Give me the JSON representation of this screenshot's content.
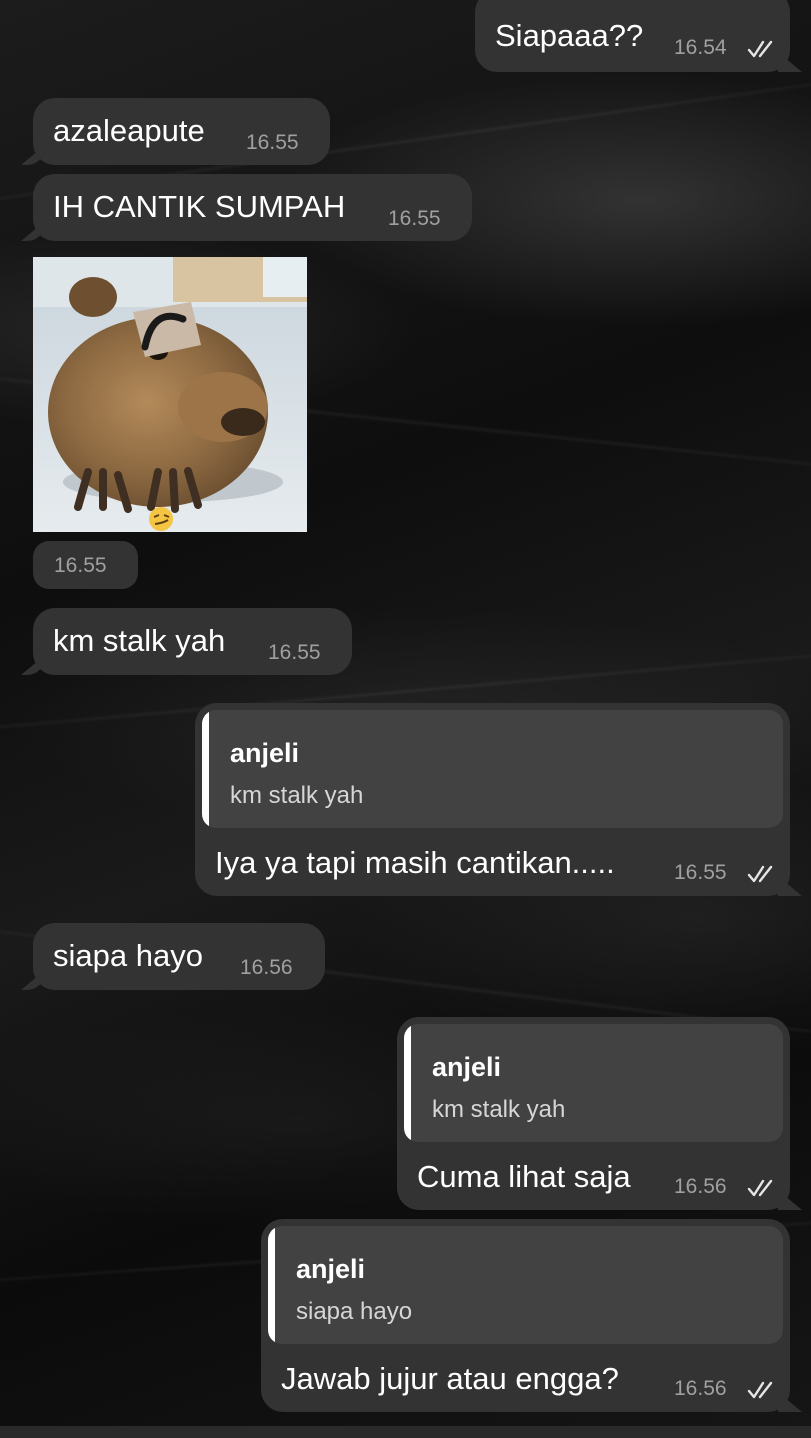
{
  "messages": {
    "m1": {
      "text": "Siapaaa??",
      "time": "16.54"
    },
    "m2": {
      "text": "azaleapute",
      "time": "16.55"
    },
    "m3": {
      "text": "IH CANTIK SUMPAH",
      "time": "16.55"
    },
    "m4": {
      "time": "16.55"
    },
    "m5": {
      "text": "km stalk yah",
      "time": "16.55"
    },
    "m6": {
      "reply_name": "anjeli",
      "reply_text": "km stalk yah",
      "text": "Iya ya tapi masih cantikan.....",
      "time": "16.55"
    },
    "m7": {
      "text": "siapa hayo",
      "time": "16.56"
    },
    "m8": {
      "reply_name": "anjeli",
      "reply_text": "km stalk yah",
      "text": "Cuma lihat saja",
      "time": "16.56"
    },
    "m9": {
      "reply_name": "anjeli",
      "reply_text": "siapa hayo",
      "text": "Jawab jujur atau engga?",
      "time": "16.56"
    }
  },
  "colors": {
    "bubble": "#333333",
    "reply_box": "#424242",
    "reply_bar": "#ffffff",
    "time": "#a0a0a0"
  },
  "icons": {
    "read_receipt": "double-check-icon",
    "sticker_emoji": "smirk-emoji-icon"
  }
}
